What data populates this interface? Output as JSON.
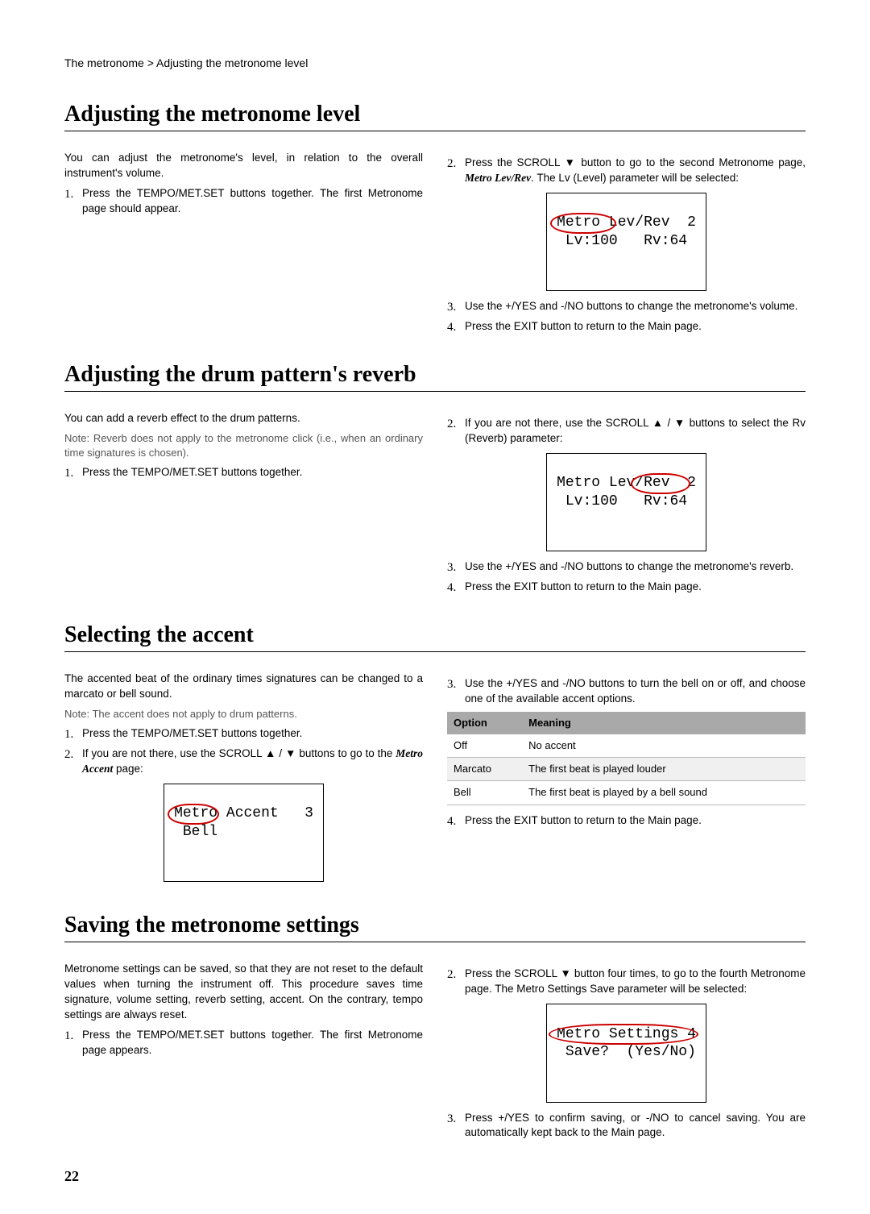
{
  "breadcrumb": "The metronome  > Adjusting the metronome level",
  "page_number": "22",
  "sec1": {
    "heading": "Adjusting the metronome level",
    "intro": "You can adjust the metronome's level, in relation to the overall instrument's volume.",
    "s1": "Press the TEMPO/MET.SET buttons together. The first Metronome page should appear.",
    "s2a": "Press the SCROLL ",
    "s2b": " button to go to the second Metronome page, ",
    "s2c": ". The Lv (Level) parameter will be selected:",
    "page_ref": "Metro Lev/Rev",
    "lcd_l1": "Metro Lev/Rev  2",
    "lcd_l2": " Lv:100   Rv:64",
    "s3": "Use the +/YES and -/NO buttons to change the metronome's volume.",
    "s4": "Press the EXIT button to return to the Main page."
  },
  "sec2": {
    "heading": "Adjusting the drum pattern's reverb",
    "intro": "You can add a reverb effect to the drum patterns.",
    "note": "Note: Reverb does not apply to the metronome click (i.e., when an ordinary time signatures is chosen).",
    "s1": "Press the TEMPO/MET.SET buttons together.",
    "s2a": "If you are not there, use the SCROLL ",
    "s2b": " / ",
    "s2c": " buttons to select the Rv (Reverb) parameter:",
    "lcd_l1": "Metro Lev/Rev  2",
    "lcd_l2": " Lv:100   Rv:64",
    "s3": "Use the +/YES and -/NO buttons to change the metronome's reverb.",
    "s4": "Press the EXIT button to return to the Main page."
  },
  "sec3": {
    "heading": "Selecting the accent",
    "intro": "The accented beat of the ordinary times signatures can be changed to a marcato or bell sound.",
    "note": "Note: The accent does not apply to drum patterns.",
    "s1": "Press the TEMPO/MET.SET buttons together.",
    "s2a": "If you are not there, use the SCROLL ",
    "s2b": " / ",
    "s2c": " buttons to go to the ",
    "s2d": " page:",
    "page_ref": "Metro Accent",
    "lcd_l1": "Metro Accent   3",
    "lcd_l2": " Bell",
    "s3": "Use the +/YES and -/NO buttons to turn the bell on or off, and choose one of the available accent options.",
    "table": {
      "h1": "Option",
      "h2": "Meaning",
      "rows": [
        {
          "o": "Off",
          "m": "No accent"
        },
        {
          "o": "Marcato",
          "m": "The first beat is played louder"
        },
        {
          "o": "Bell",
          "m": "The first beat is played by a bell sound"
        }
      ]
    },
    "s4": "Press the EXIT button to return to the Main page."
  },
  "sec4": {
    "heading": "Saving the metronome settings",
    "intro": "Metronome settings can be saved, so that they are not reset to the default values when turning the instrument off. This procedure saves time signature, volume setting, reverb setting, accent. On the contrary, tempo settings are always reset.",
    "s1": "Press the TEMPO/MET.SET buttons together. The first Metronome page appears.",
    "s2a": "Press the SCROLL ",
    "s2b": " button four times, to go to the fourth Metronome page. The Metro Settings Save parameter will be selected:",
    "lcd_l1": "Metro Settings 4",
    "lcd_l2": " Save?  (Yes/No)",
    "s3": "Press +/YES to confirm saving, or -/NO to cancel saving. You are automatically kept back to the Main page."
  }
}
